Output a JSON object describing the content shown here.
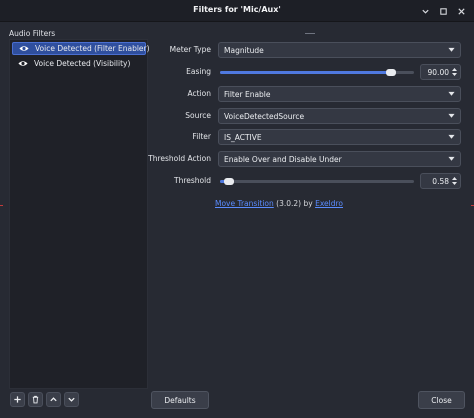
{
  "window": {
    "title": "Filters for 'Mic/Aux'"
  },
  "titlebar_icons": [
    "chevron-down-icon",
    "restore-icon",
    "close-icon"
  ],
  "left": {
    "section_label": "Audio Filters",
    "filters": [
      {
        "label": "Voice Detected (Filter Enabler)",
        "icon": "eye-icon",
        "selected": true
      },
      {
        "label": "Voice Detected (Visibility)",
        "icon": "eye-icon",
        "selected": false
      }
    ],
    "buttons": [
      "add-icon",
      "trash-icon",
      "move-up-icon",
      "move-down-icon"
    ]
  },
  "props": {
    "meter_type": {
      "label": "Meter Type",
      "value": "Magnitude"
    },
    "easing": {
      "label": "Easing",
      "value": "90.00",
      "fraction": 0.9
    },
    "action": {
      "label": "Action",
      "value": "Filter Enable"
    },
    "source": {
      "label": "Source",
      "value": "VoiceDetectedSource"
    },
    "filter": {
      "label": "Filter",
      "value": "IS_ACTIVE"
    },
    "threshold_action": {
      "label": "Threshold Action",
      "value": "Enable Over and Disable Under"
    },
    "threshold": {
      "label": "Threshold",
      "value": "0.58",
      "fraction": 0.02
    },
    "credit": {
      "link": "Move Transition",
      "version": " (3.0.2) by ",
      "author": "Exeldro"
    }
  },
  "footer": {
    "defaults_label": "Defaults",
    "close_label": "Close"
  },
  "colors": {
    "accent": "#4f79e0",
    "selected": "#2f4f9e",
    "link": "#5a8cff"
  }
}
